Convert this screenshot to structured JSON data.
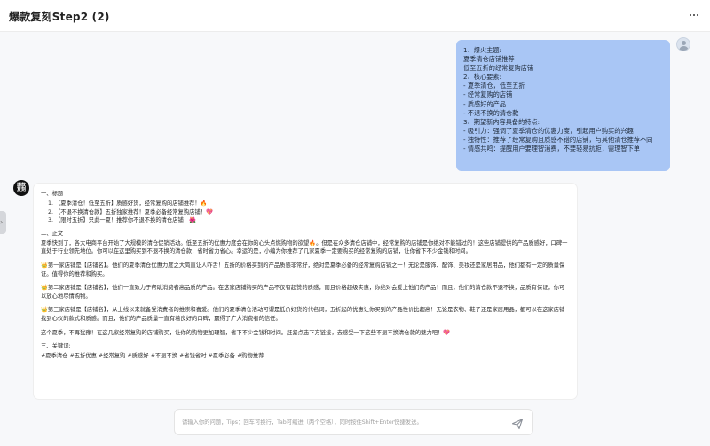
{
  "header": {
    "title": "爆款复刻Step2 (2)",
    "more_icon": "more-horizontal-icon"
  },
  "user_message": {
    "lines": [
      "1、爆火主题:",
      "夏季清仓店铺推荐",
      "低至五折的经常复购店铺",
      "2、核心要素:",
      "- 夏季清仓，低至五折",
      "- 经常复购的店铺",
      "- 质感好的产品",
      "- 不退不换的清仓款",
      "3、期望新内容具备的特点:",
      "- 吸引力：强调了夏季清仓的优惠力度，引起用户购买的兴趣",
      "- 独特性：推荐了经常复购且质感不错的店铺，与其他清仓推荐不同",
      "- 情感共鸣：提醒用户要理智消费，不要轻易抗拒，需理智下单"
    ]
  },
  "bot_avatar_text": "爆款\n复刻",
  "bot_message": {
    "heading_titles": "一、标题",
    "titles": [
      "1. 【夏季清仓！低至五折】质感好货，经常复购的店铺推荐！🔥",
      "2. 【不退不换清仓款】五折独家推荐！夏季必备经常复购店铺！💖",
      "3. 【限时五折】只此一夏！推荐你不退不换的清仓店铺！🌺"
    ],
    "heading_body": "二、正文",
    "paragraphs": [
      "夏季快到了，各大电商平台开始了大规模的清仓促销活动。低至五折的优惠力度会在你的心头点燃购物的欲望🔥。但是在众多清仓店铺中，经常复购的店铺是你绝对不能错过的！这些店铺提供的产品质感好，口碑一直处于行业领先地位。你可以在这里购买到不退不换的清仓款，省时省力省心。幸运的是，小编为你推荐了几家夏季一定要购买的经常复购的店铺，让你省下不少金钱和时间。",
      "👑第一家店铺是【店铺名】。他们的夏季清仓优惠力度之大简直让人咋舌！五折的价格买到的产品质感非常好，绝对是夏季必备的经常复购店铺之一！无论是服饰、配饰、美妆还是家居用品，他们都有一定的质量保证。值得你的推荐和购买。",
      "👑第二家店铺是【店铺名】，他们一直致力于帮助消费者高品质的产品。在这家店铺购买的产品不仅有超赞的质感，而且价格超级实惠，你绝对会爱上他们的产品！而且，他们的清仓款不退不换，品质有保证，你可以放心地尽情购物。",
      "👑第三家店铺是【店铺名】，从上线以来就备受消费者的推崇和喜爱。他们的夏季清仓活动可谓是低价好货的代名词，五折起的优惠让你买到的产品性价比超高！无论是衣物、鞋子还是家居用品，都可以在这家店铺找到心仪的款式和质感。而且，他们的产品质量一直有着良好的口碑，赢得了广大消费者的信任。",
      "这个夏季，不再犹豫！在这几家经常复购的店铺购买，让你的购物更加理智，省下不少金钱和时间。赶紧点击下方链接，去感受一下这些不退不换清仓款的魅力吧！💖"
    ],
    "heading_keywords": "三、关键词:",
    "keywords": "#夏季清仓 #五折优惠 #经常复购 #质感好 #不退不换 #省钱省时 #夏季必备 #购物推荐"
  },
  "input": {
    "placeholder": "请输入你的问题，Tips：回车可换行，Tab可缩进（两个空格），同时按住Shift+Enter快捷发送。",
    "value": ""
  },
  "icons": {
    "send": "send-icon",
    "user_avatar": "user-avatar-icon",
    "sidebar_toggle": "chevron-right-icon"
  },
  "colors": {
    "user_bubble": "#a9c6f5",
    "background": "#f7f8fa",
    "card": "#ffffff"
  }
}
